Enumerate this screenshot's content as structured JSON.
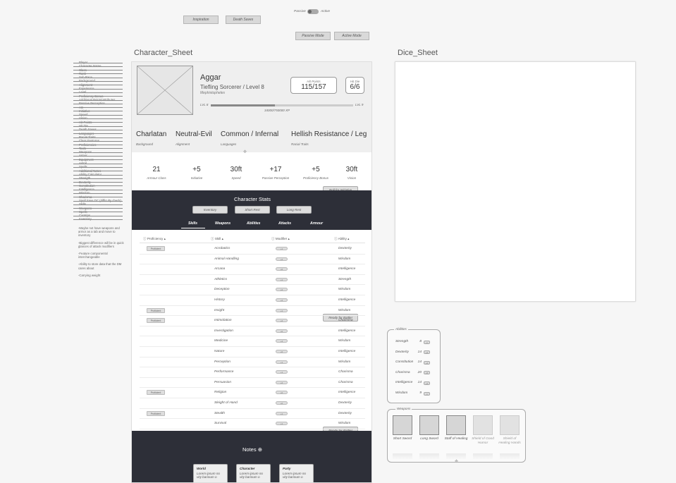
{
  "top_controls": {
    "toggle_left": "Passive",
    "toggle_right": "Active",
    "inspiration": "Inspiration",
    "death_saves": "Death Saves",
    "passive_mode": "Passive Mode",
    "active_mode": "Active Mode"
  },
  "frames": {
    "character": "Character_Sheet",
    "dice": "Dice_Sheet"
  },
  "checklist": [
    "Player",
    "Character Name",
    "Class",
    "Rank",
    "Sub Race",
    "Background",
    "Alignment",
    "Experience",
    "Level",
    "Proficiency Bonus",
    "Additional Points/Attributes",
    "Passive Perception",
    "AC",
    "Initiative",
    "Speed",
    "Vision",
    "Hit Points",
    "Hit Die",
    "Death Saves",
    "Languages",
    "Racial Traits",
    "Class Features",
    "Proficiencies",
    "Tools",
    "Weapons",
    "Armor",
    "Equipment",
    "Astral",
    "Spells",
    "Additional Notes",
    "Ability Calculator",
    "Strength",
    "Dexterity",
    "Constitution",
    "Intelligence",
    "Wisdom",
    "Charisma",
    "Spell Save DC (difficulty check)",
    "Skills",
    "Weapons",
    "Spells",
    "Cantrips",
    "Inventory"
  ],
  "side_notes": [
    "-Maybe not have weapons and armor as a tab and move to inventory",
    "-Biggest difference will be in quick glances of attack modifiers",
    "-Feature components/ interchangeable",
    "-Ability to store data that the DM cares about",
    "-Carrying weight"
  ],
  "character": {
    "name": "Aggar",
    "class_line": "Tiefling Sorcerer / Level 8",
    "subtitle": "Mephistopheles",
    "hit_points_label": "Hit Points",
    "hit_points": "115/157",
    "hit_die_label": "Hit Die",
    "hit_die": "6/6",
    "lvl_left": "LVL 8",
    "lvl_right": "LVL 9",
    "xp": "34000/750000 XP",
    "xp_progress": 0.45
  },
  "traits": [
    {
      "value": "Charlatan",
      "label": "Background"
    },
    {
      "value": "Neutral-Evil",
      "label": "Alignment"
    },
    {
      "value": "Common / Infernal",
      "label": "Languages"
    },
    {
      "value": "Hellish Resistance / Leg",
      "label": "Racial Traits"
    }
  ],
  "stats": [
    {
      "value": "21",
      "label": "Armour Class"
    },
    {
      "value": "+5",
      "label": "Initiative"
    },
    {
      "value": "30ft",
      "label": "Speed"
    },
    {
      "value": "+17",
      "label": "Passive Perception"
    },
    {
      "value": "+5",
      "label": "Proficiency Bonus"
    },
    {
      "value": "30ft",
      "label": "Vision"
    }
  ],
  "roll_initiative": "Roll for Initiative",
  "char_stats": {
    "title": "Character Stats",
    "buttons": [
      "Inventory",
      "Short Rest",
      "Long Rest"
    ],
    "tabs": [
      "Skills",
      "Weapons",
      "Abilities",
      "Attacks",
      "Armour"
    ]
  },
  "skills_table": {
    "headers": [
      "Proficiency",
      "Skill",
      "Modifier",
      "Ability"
    ],
    "badge": "Proficient",
    "rows": [
      {
        "prof": true,
        "skill": "Acrobatics",
        "mod": "+1",
        "ability": "Dexterity"
      },
      {
        "prof": false,
        "skill": "Animal Handling",
        "mod": "+2",
        "ability": "Wisdom"
      },
      {
        "prof": false,
        "skill": "Arcana",
        "mod": "+0",
        "ability": "Intelligence"
      },
      {
        "prof": false,
        "skill": "Athletics",
        "mod": "+1",
        "ability": "Strength"
      },
      {
        "prof": false,
        "skill": "Deception",
        "mod": "+2",
        "ability": "Wisdom"
      },
      {
        "prof": false,
        "skill": "History",
        "mod": "+2",
        "ability": "Intelligence"
      },
      {
        "prof": true,
        "skill": "Insight",
        "mod": "+1",
        "ability": "Wisdom"
      },
      {
        "prof": true,
        "skill": "Intimidation",
        "mod": "+2",
        "ability": "Charisma"
      },
      {
        "prof": false,
        "skill": "Investigation",
        "mod": "+0",
        "ability": "Intelligence"
      },
      {
        "prof": false,
        "skill": "Medicine",
        "mod": "+4",
        "ability": "Wisdom"
      },
      {
        "prof": false,
        "skill": "Nature",
        "mod": "+0",
        "ability": "Intelligence"
      },
      {
        "prof": false,
        "skill": "Perception",
        "mod": "+1",
        "ability": "Wisdom"
      },
      {
        "prof": false,
        "skill": "Performance",
        "mod": "+1",
        "ability": "Charisma"
      },
      {
        "prof": false,
        "skill": "Persuasion",
        "mod": "+2",
        "ability": "Charisma"
      },
      {
        "prof": true,
        "skill": "Religion",
        "mod": "+0",
        "ability": "Intelligence"
      },
      {
        "prof": false,
        "skill": "Sleight of Hand",
        "mod": "+0",
        "ability": "Dexterity"
      },
      {
        "prof": true,
        "skill": "Stealth",
        "mod": "+1",
        "ability": "Dexterity"
      },
      {
        "prof": false,
        "skill": "Survival",
        "mod": "+1",
        "ability": "Wisdom"
      }
    ]
  },
  "ready_for_battle": "Ready for Battle!",
  "notes": {
    "title": "Notes",
    "cards": [
      {
        "title": "World",
        "text": "Lorem ipsum no vity barinum o"
      },
      {
        "title": "Character",
        "text": "Lorem ipsum no vity barinum o"
      },
      {
        "title": "Party",
        "text": "Lorem ipsum no vity barinum o"
      }
    ]
  },
  "abilities_panel": {
    "title": "Abilities",
    "items": [
      {
        "name": "Strength",
        "score": "8",
        "mod": "-1"
      },
      {
        "name": "Dexterity",
        "score": "14",
        "mod": "+2"
      },
      {
        "name": "Constitution",
        "score": "14",
        "mod": "+2"
      },
      {
        "name": "Charisma",
        "score": "20",
        "mod": "+5"
      },
      {
        "name": "Intelligence",
        "score": "14",
        "mod": "+2"
      },
      {
        "name": "Wisdom",
        "score": "9",
        "mod": "-1"
      }
    ]
  },
  "weapons_panel": {
    "title": "Weapons",
    "items": [
      {
        "name": "Short Sword",
        "faded": false
      },
      {
        "name": "Long Sword",
        "faded": false
      },
      {
        "name": "Staff of Healing",
        "faded": false
      },
      {
        "name": "Shield of Good Humor",
        "faded": true
      },
      {
        "name": "Shield of Healing Hands",
        "faded": true
      }
    ]
  },
  "colors": {
    "dark": "#2d2f38",
    "button": "#d9d9d9",
    "canvas": "#f6f6f6"
  }
}
